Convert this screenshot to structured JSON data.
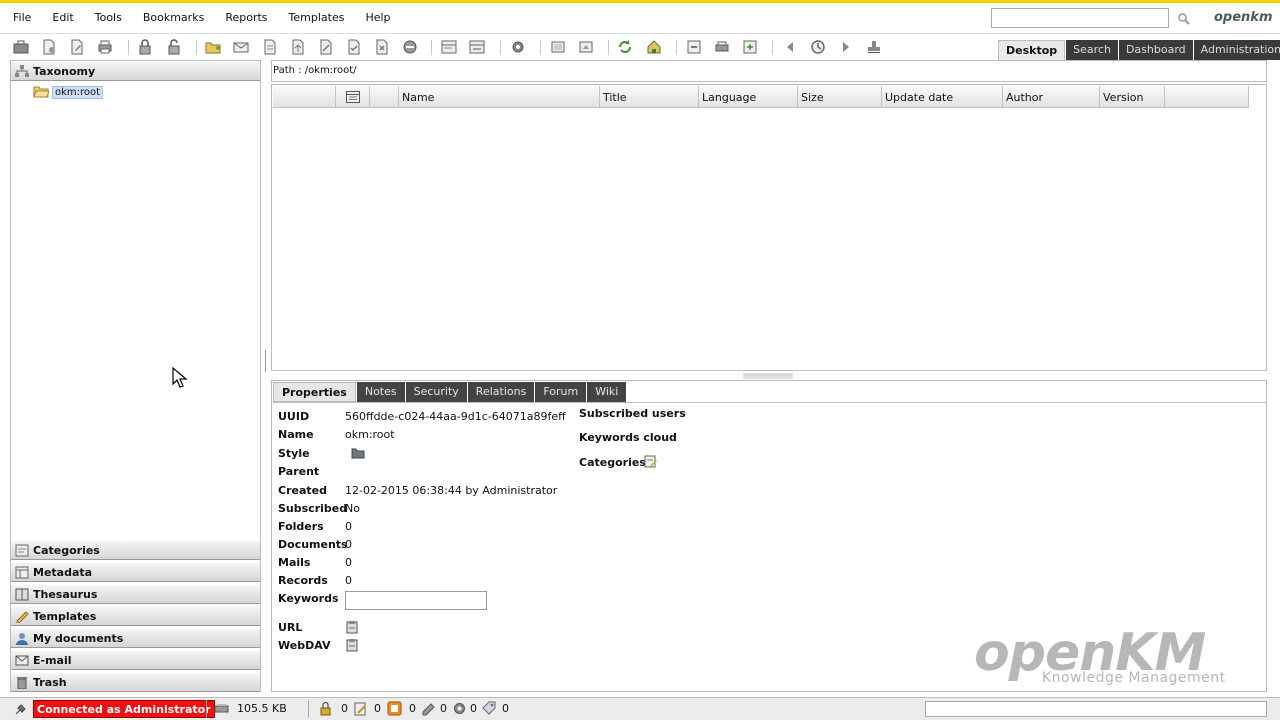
{
  "menu": {
    "items": [
      {
        "label": "File"
      },
      {
        "label": "Edit"
      },
      {
        "label": "Tools"
      },
      {
        "label": "Bookmarks"
      },
      {
        "label": "Reports"
      },
      {
        "label": "Templates"
      },
      {
        "label": "Help"
      }
    ],
    "search_value": "",
    "brand": "openkm"
  },
  "main_tabs": [
    {
      "label": "Desktop",
      "active": true
    },
    {
      "label": "Search",
      "active": false
    },
    {
      "label": "Dashboard",
      "active": false
    },
    {
      "label": "Administration",
      "active": false
    }
  ],
  "left": {
    "taxonomy": "Taxonomy",
    "root_node": "okm:root",
    "stacks": [
      {
        "label": "Categories",
        "icon": "categories-icon"
      },
      {
        "label": "Metadata",
        "icon": "metadata-icon"
      },
      {
        "label": "Thesaurus",
        "icon": "thesaurus-icon"
      },
      {
        "label": "Templates",
        "icon": "templates-icon"
      },
      {
        "label": "My documents",
        "icon": "user-icon"
      },
      {
        "label": "E-mail",
        "icon": "mail-icon"
      },
      {
        "label": "Trash",
        "icon": "trash-icon"
      }
    ]
  },
  "browser": {
    "path": "Path : /okm:root/",
    "columns": [
      "",
      "",
      "",
      "Name",
      "Title",
      "Language",
      "Size",
      "Update date",
      "Author",
      "Version",
      ""
    ]
  },
  "properties": {
    "tabs": [
      {
        "label": "Properties",
        "active": true
      },
      {
        "label": "Notes",
        "active": false
      },
      {
        "label": "Security",
        "active": false
      },
      {
        "label": "Relations",
        "active": false
      },
      {
        "label": "Forum",
        "active": false
      },
      {
        "label": "Wiki",
        "active": false
      }
    ],
    "fields": {
      "uuid_label": "UUID",
      "uuid": "560ffdde-c024-44aa-9d1c-64071a89feff",
      "name_label": "Name",
      "name": "okm:root",
      "style_label": "Style",
      "parent_label": "Parent",
      "created_label": "Created",
      "created": "12-02-2015 06:38:44 by Administrator",
      "subscribed_label": "Subscribed",
      "subscribed": "No",
      "folders_label": "Folders",
      "folders": "0",
      "documents_label": "Documents",
      "documents": "0",
      "mails_label": "Mails",
      "mails": "0",
      "records_label": "Records",
      "records": "0",
      "keywords_label": "Keywords",
      "keywords": "",
      "url_label": "URL",
      "webdav_label": "WebDAV"
    },
    "right": {
      "subscribed_users": "Subscribed users",
      "keywords_cloud": "Keywords cloud",
      "categories": "Categories"
    },
    "watermark": {
      "logo": "openKM",
      "subtitle": "Knowledge Management"
    }
  },
  "status": {
    "connection": "Connected as Administrator",
    "size": "105.5 KB",
    "counters": [
      "0",
      "0",
      "0",
      "0",
      "0",
      "0"
    ]
  },
  "colors": {
    "accent": "#f1d300",
    "connection_bg": "#e11111",
    "tab_dark": "#3a3a3a",
    "selection": "#cfe0f5"
  }
}
